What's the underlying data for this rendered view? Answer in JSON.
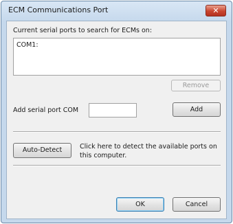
{
  "window": {
    "title": "ECM Communications Port",
    "close_symbol": "✕"
  },
  "serial_ports": {
    "heading": "Current serial ports to search for ECMs on:",
    "items": [
      "COM1:"
    ],
    "remove_label": "Remove"
  },
  "add_port": {
    "label": "Add serial port COM",
    "value": "",
    "add_label": "Add"
  },
  "auto_detect": {
    "button_label": "Auto-Detect",
    "description": "Click here to detect the available ports on this computer."
  },
  "footer": {
    "ok_label": "OK",
    "cancel_label": "Cancel"
  }
}
